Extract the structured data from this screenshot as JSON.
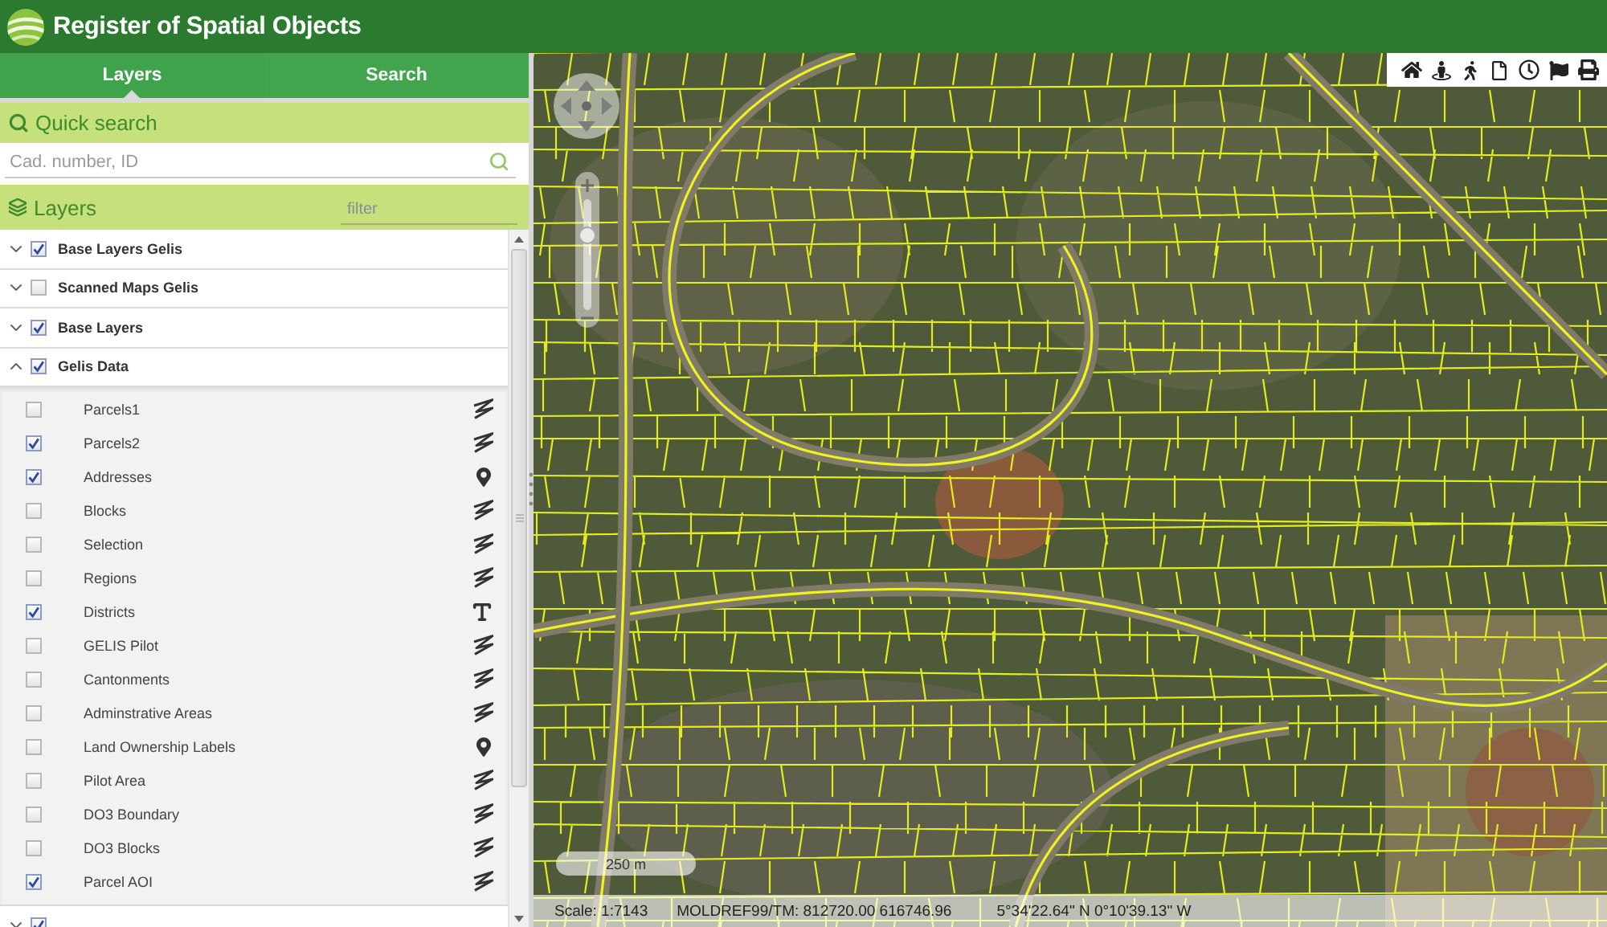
{
  "header": {
    "title": "Register of Spatial Objects"
  },
  "tabs": [
    {
      "label": "Layers",
      "selected": true
    },
    {
      "label": "Search",
      "selected": false
    }
  ],
  "quick_search": {
    "title": "Quick search",
    "placeholder": "Cad. number, ID"
  },
  "layers_panel": {
    "title": "Layers",
    "filter_placeholder": "filter",
    "groups": [
      {
        "label": "Base Layers Gelis",
        "checked": true,
        "expanded": false
      },
      {
        "label": "Scanned Maps Gelis",
        "checked": false,
        "expanded": false
      },
      {
        "label": "Base Layers",
        "checked": true,
        "expanded": false
      },
      {
        "label": "Gelis Data",
        "checked": true,
        "expanded": true,
        "children": [
          {
            "label": "Parcels1",
            "checked": false,
            "kind": "line"
          },
          {
            "label": "Parcels2",
            "checked": true,
            "kind": "line"
          },
          {
            "label": "Addresses",
            "checked": true,
            "kind": "point"
          },
          {
            "label": "Blocks",
            "checked": false,
            "kind": "line"
          },
          {
            "label": "Selection",
            "checked": false,
            "kind": "line"
          },
          {
            "label": "Regions",
            "checked": false,
            "kind": "line"
          },
          {
            "label": "Districts",
            "checked": true,
            "kind": "text"
          },
          {
            "label": "GELIS Pilot",
            "checked": false,
            "kind": "line"
          },
          {
            "label": "Cantonments",
            "checked": false,
            "kind": "line"
          },
          {
            "label": "Adminstrative Areas",
            "checked": false,
            "kind": "line"
          },
          {
            "label": "Land Ownership Labels",
            "checked": false,
            "kind": "point"
          },
          {
            "label": "Pilot Area",
            "checked": false,
            "kind": "line"
          },
          {
            "label": "DO3 Boundary",
            "checked": false,
            "kind": "line"
          },
          {
            "label": "DO3 Blocks",
            "checked": false,
            "kind": "line"
          },
          {
            "label": "Parcel AOI",
            "checked": true,
            "kind": "line"
          }
        ]
      },
      {
        "checked": true,
        "expanded": false
      }
    ]
  },
  "map": {
    "zoom_slider": {
      "level": 0.7
    },
    "scale_bar": "250 m",
    "status_bar": {
      "scale": "Scale: 1:7143",
      "projected_coordinates": "MOLDREF99/TM: 812720.00 616746.96",
      "geographic_coordinates": "5°34'22.64\" N 0°10'39.13\" W"
    }
  }
}
